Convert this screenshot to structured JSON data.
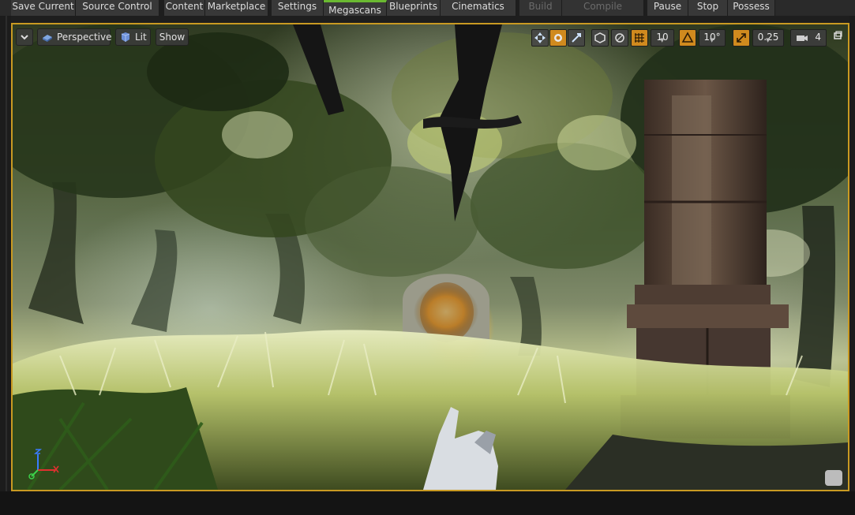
{
  "toolbar": {
    "save_current": "Save Current",
    "source_control": "Source Control",
    "content": "Content",
    "marketplace": "Marketplace",
    "settings": "Settings",
    "megascans": "Megascans",
    "blueprints": "Blueprints",
    "cinematics": "Cinematics",
    "build": "Build",
    "compile": "Compile",
    "pause": "Pause",
    "stop": "Stop",
    "possess": "Possess"
  },
  "viewport": {
    "perspective_label": "Perspective",
    "lit_label": "Lit",
    "show_label": "Show",
    "grid_snap_value": "10",
    "rotation_snap_value": "10°",
    "scale_snap_value": "0.25",
    "camera_speed_value": "4"
  },
  "colors": {
    "selection_border": "#c99a22",
    "active_snap": "#d08a1e",
    "megascans_accent": "#6ab931"
  },
  "icons": {
    "viewport_menu": "chevron-down-icon",
    "perspective": "perspective-cube-icon",
    "lit": "lit-sphere-icon",
    "translate": "translate-arrows-icon",
    "rotate": "rotate-icon",
    "scale": "scale-icon",
    "world_local": "world-icon",
    "surface_snap": "surface-snap-icon",
    "grid_snap": "grid-icon",
    "rotation_snap": "angle-icon",
    "scale_snap": "scale-snap-icon",
    "camera_speed": "camera-icon",
    "maximize": "maximize-icon"
  }
}
